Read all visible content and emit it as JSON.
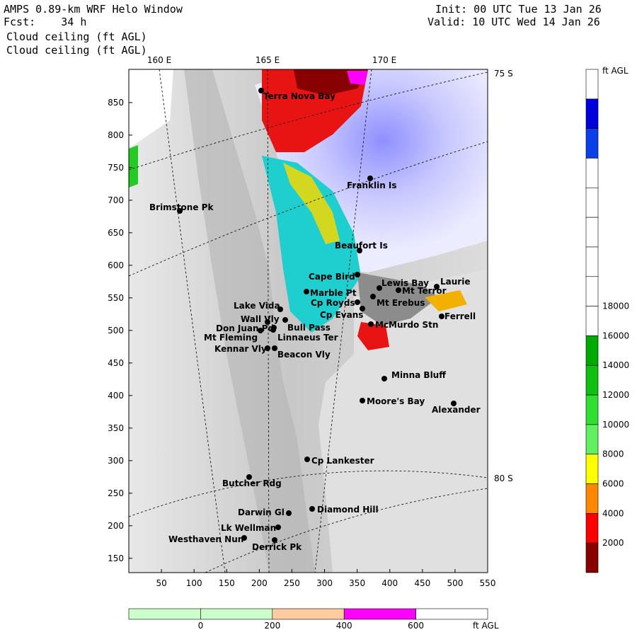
{
  "header": {
    "left_line1": "AMPS 0.89-km WRF Helo Window",
    "left_line2": "Fcst:    34 h",
    "left_line3": "Cloud ceiling (ft AGL)",
    "left_line4": "Cloud ceiling (ft AGL)",
    "right_line1": "Init: 00 UTC Tue 13 Jan 26",
    "right_line2": "Valid: 10 UTC Wed 14 Jan 26"
  },
  "map": {
    "longitude_labels": [
      "160 E",
      "165 E",
      "170 E"
    ],
    "latitude_labels": [
      "75 S",
      "80 S"
    ],
    "x_ticks": [
      "50",
      "100",
      "150",
      "200",
      "250",
      "300",
      "350",
      "400",
      "450",
      "500",
      "550"
    ],
    "y_ticks": [
      "850",
      "800",
      "750",
      "700",
      "650",
      "600",
      "550",
      "500",
      "450",
      "400",
      "350",
      "300",
      "250",
      "200",
      "150"
    ],
    "places": [
      {
        "name": "Terra Nova Bay"
      },
      {
        "name": "Franklin Is"
      },
      {
        "name": "Brimstone Pk"
      },
      {
        "name": "Beaufort Is"
      },
      {
        "name": "Cape Bird"
      },
      {
        "name": "Lewis Bay"
      },
      {
        "name": "Laurie"
      },
      {
        "name": "Mt Terror"
      },
      {
        "name": "Marble Pt"
      },
      {
        "name": "Cp Royds"
      },
      {
        "name": "Mt Erebus"
      },
      {
        "name": "Lake Vida"
      },
      {
        "name": "Cp Evans"
      },
      {
        "name": "Ferrell"
      },
      {
        "name": "Wall Vly"
      },
      {
        "name": "Don Juan Pd"
      },
      {
        "name": "Bull Pass"
      },
      {
        "name": "McMurdo Stn"
      },
      {
        "name": "Mt Fleming"
      },
      {
        "name": "Linnaeus Ter"
      },
      {
        "name": "Kennar Vly"
      },
      {
        "name": "Beacon Vly"
      },
      {
        "name": "Minna Bluff"
      },
      {
        "name": "Moore's Bay"
      },
      {
        "name": "Alexander"
      },
      {
        "name": "Cp Lankester"
      },
      {
        "name": "Butcher Rdg"
      },
      {
        "name": "Darwin Gl"
      },
      {
        "name": "Diamond Hill"
      },
      {
        "name": "Lk Wellman"
      },
      {
        "name": "Westhaven Nun"
      },
      {
        "name": "Derrick Pk"
      }
    ]
  },
  "colorbar": {
    "unit": "ft AGL",
    "tick_labels": [
      "18000",
      "16000",
      "14000",
      "12000",
      "10000",
      "8000",
      "6000",
      "4000",
      "2000"
    ],
    "colors": [
      "#ffffff",
      "#0000dd",
      "#0b3fe8",
      "#ffffff",
      "#ffffff",
      "#ffffff",
      "#ffffff",
      "#ffffff",
      "#ffffff",
      "#00aa00",
      "#10c010",
      "#30e030",
      "#60f060",
      "#ffff00",
      "#ff8800",
      "#ff0000",
      "#880000"
    ]
  },
  "bottom_legend": {
    "tick_labels": [
      "0",
      "200",
      "400",
      "600"
    ],
    "unit": "ft AGL",
    "colors": [
      "#ccffcc",
      "#ccffcc",
      "#ffcca0",
      "#ff00ff",
      "#ffffff"
    ]
  }
}
